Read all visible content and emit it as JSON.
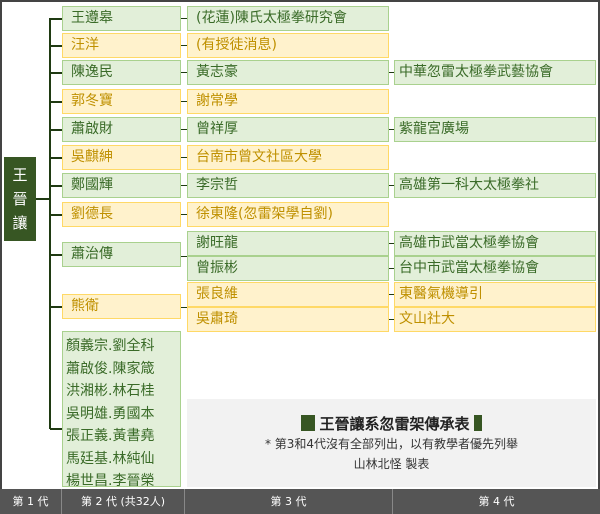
{
  "root": [
    "王",
    "晉",
    "讓"
  ],
  "rows": [
    {
      "g2": "王遵皋",
      "g3": "(花蓮)陳氏太極拳研究會",
      "color": "green"
    },
    {
      "g2": "汪洋",
      "g3": "(有授徒消息)",
      "color": "yellow"
    },
    {
      "g2": "陳逸民",
      "g3": "黃志豪",
      "g4": "中華忽雷太極拳武藝協會",
      "color": "green"
    },
    {
      "g2": "郭冬寶",
      "g3": "謝常學",
      "color": "yellow"
    },
    {
      "g2": "蕭啟財",
      "g3": "曾祥厚",
      "g4": "紫龍宮廣場",
      "color": "green"
    },
    {
      "g2": "吳麒紳",
      "g3": "台南市曾文社區大學",
      "color": "yellow"
    },
    {
      "g2": "鄭國輝",
      "g3": "李宗哲",
      "g4": "高雄第一科大太極拳社",
      "color": "green"
    },
    {
      "g2": "劉德長",
      "g3": "徐東隆(忽雷架學自劉)",
      "color": "yellow"
    }
  ],
  "xiao": {
    "g2": "蕭治傳",
    "subs": [
      {
        "g3": "謝旺龍",
        "g4": "高雄市武當太極拳協會"
      },
      {
        "g3": "曾振彬",
        "g4": "台中市武當太極拳協會"
      }
    ]
  },
  "xiong": {
    "g2": "熊衛",
    "subs": [
      {
        "g3": "張良維",
        "g4": "東醫氣機導引"
      },
      {
        "g3": "吳肅琦",
        "g4": "文山社大"
      }
    ]
  },
  "others": [
    "顏義宗.劉全科",
    "蕭啟俊.陳家箴",
    "洪湘彬.林石桂",
    "吳明雄.勇國本",
    "張正義.黃書堯",
    "馬廷基.林純仙",
    "楊世昌.李晉榮"
  ],
  "note": {
    "title": "王晉讓系忽雷架傳承表",
    "remark": "* 第3和4代沒有全部列出，以有教學者優先列舉",
    "author": "山林北怪 製表"
  },
  "footer": [
    "第 1 代",
    "第 2 代 (共32人)",
    "第 3 代",
    "第 4 代"
  ],
  "colors": {
    "green_fill": "#e2efd9",
    "yellow_fill": "#fff2cc",
    "dark_green": "#375623"
  }
}
